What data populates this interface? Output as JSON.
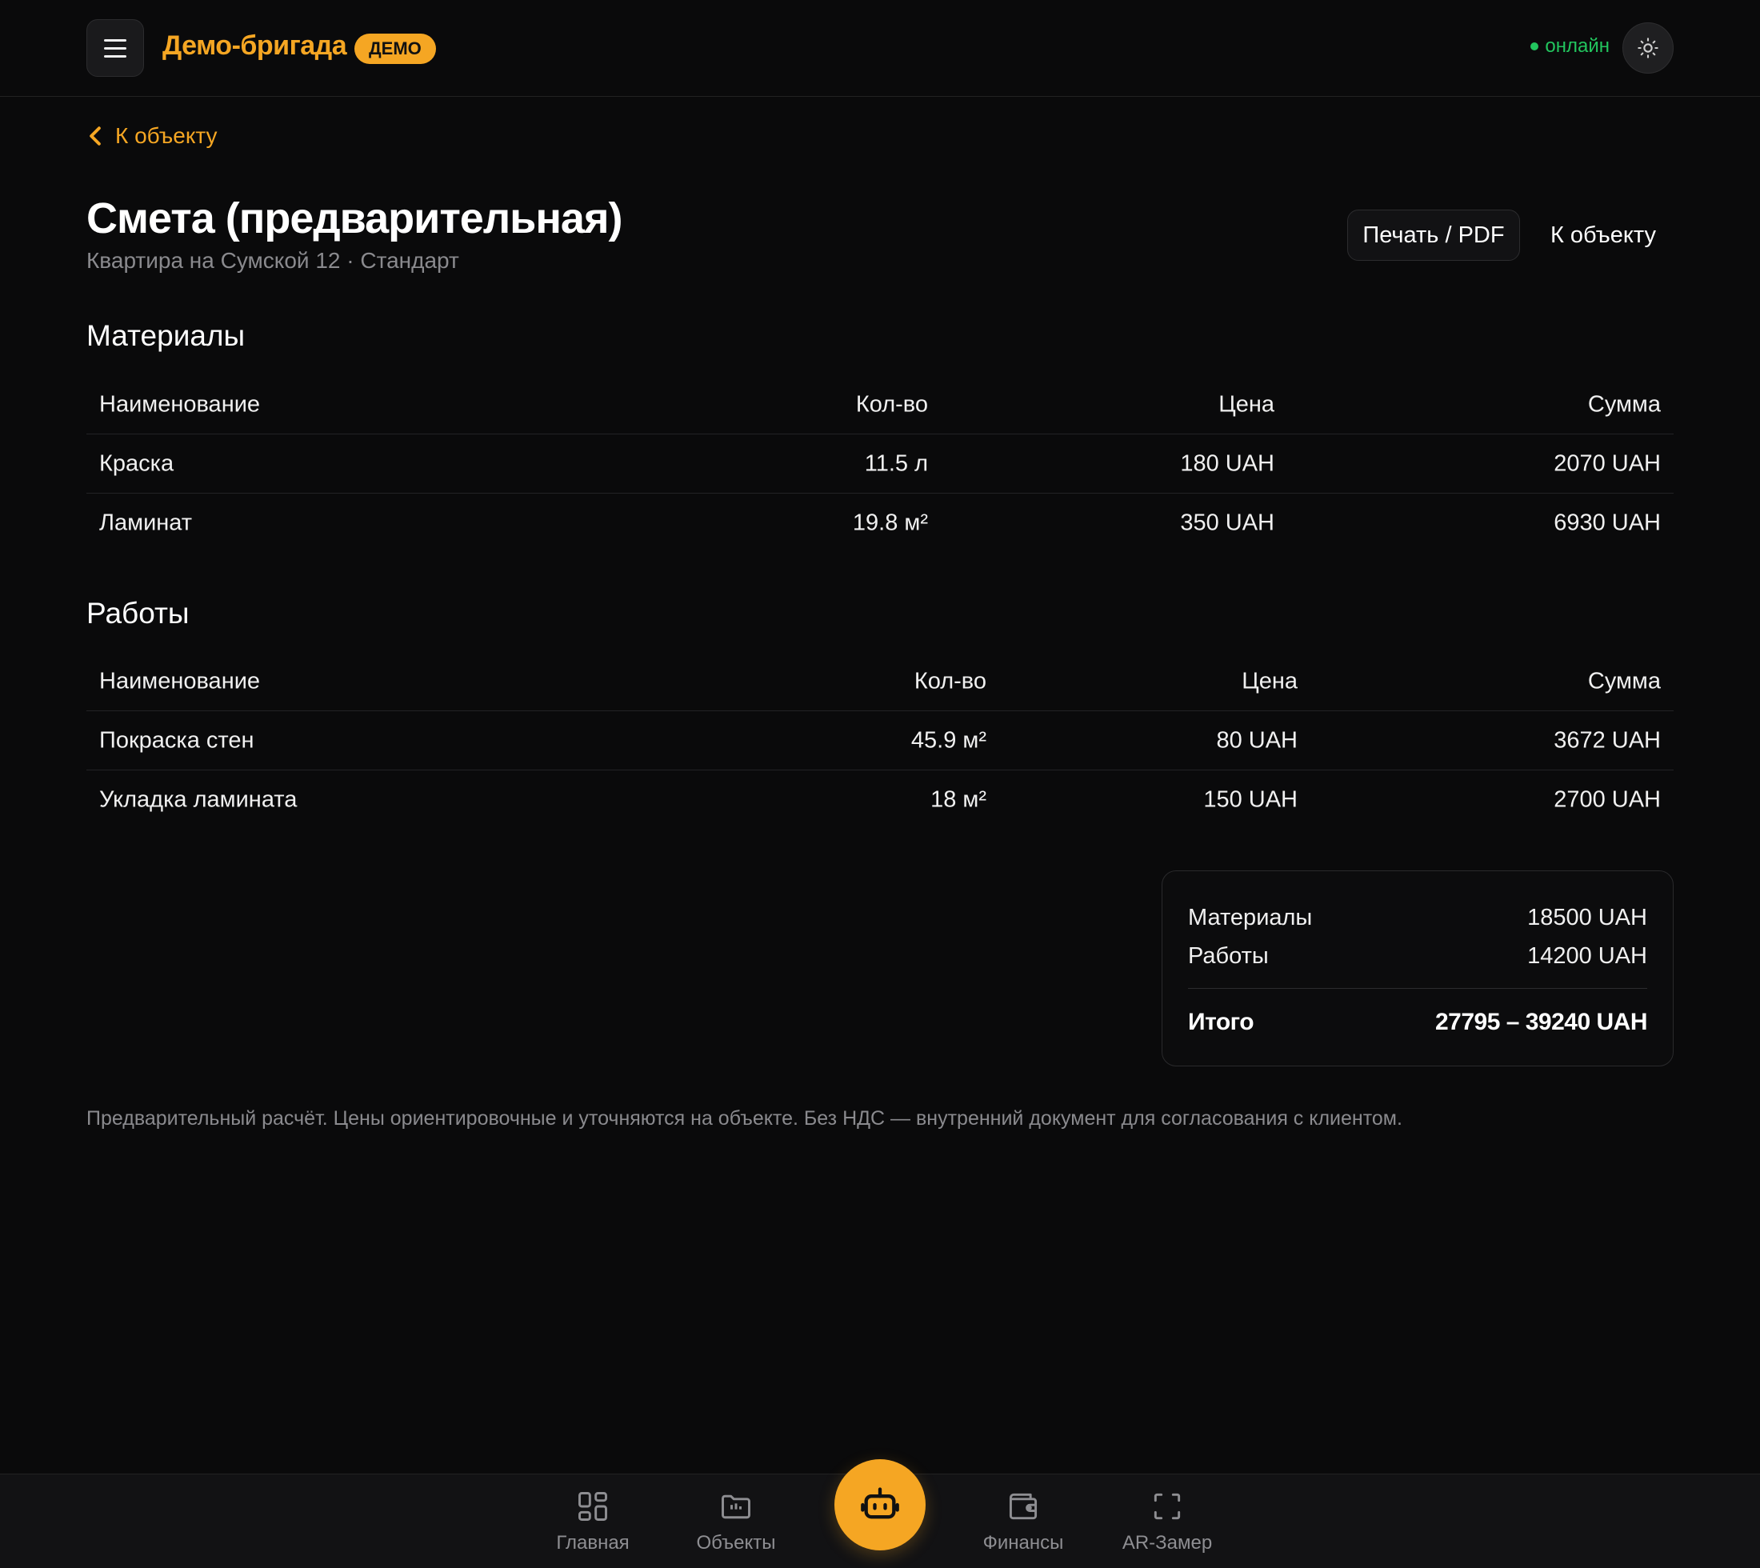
{
  "header": {
    "brand": "Демо-бригада",
    "badge": "ДЕМО",
    "status": "онлайн"
  },
  "nav_back": "К объекту",
  "page": {
    "title": "Смета (предварительная)",
    "subtitle": "Квартира на Сумской 12 · Стандарт",
    "print_label": "Печать / PDF",
    "to_object_label": "К объекту"
  },
  "materials": {
    "title": "Материалы",
    "headers": [
      "Наименование",
      "Кол-во",
      "Цена",
      "Сумма"
    ],
    "rows": [
      [
        "Краска",
        "11.5 л",
        "180 UAH",
        "2070 UAH"
      ],
      [
        "Ламинат",
        "19.8 м²",
        "350 UAH",
        "6930 UAH"
      ]
    ]
  },
  "works": {
    "title": "Работы",
    "headers": [
      "Наименование",
      "Кол-во",
      "Цена",
      "Сумма"
    ],
    "rows": [
      [
        "Покраска стен",
        "45.9 м²",
        "80 UAH",
        "3672 UAH"
      ],
      [
        "Укладка ламината",
        "18 м²",
        "150 UAH",
        "2700 UAH"
      ]
    ]
  },
  "summary": {
    "materials_label": "Материалы",
    "materials_value": "18500 UAH",
    "works_label": "Работы",
    "works_value": "14200 UAH",
    "total_label": "Итого",
    "total_value": "27795 – 39240 UAH"
  },
  "note": "Предварительный расчёт. Цены ориентировочные и уточняются на объекте. Без НДС — внутренний документ для согласования с клиентом.",
  "bottom_nav": {
    "home": "Главная",
    "objects": "Объекты",
    "finance": "Финансы",
    "ar": "AR-Замер"
  },
  "colors": {
    "accent": "#f5a623",
    "online": "#22c55e",
    "background": "#0a0a0b"
  }
}
